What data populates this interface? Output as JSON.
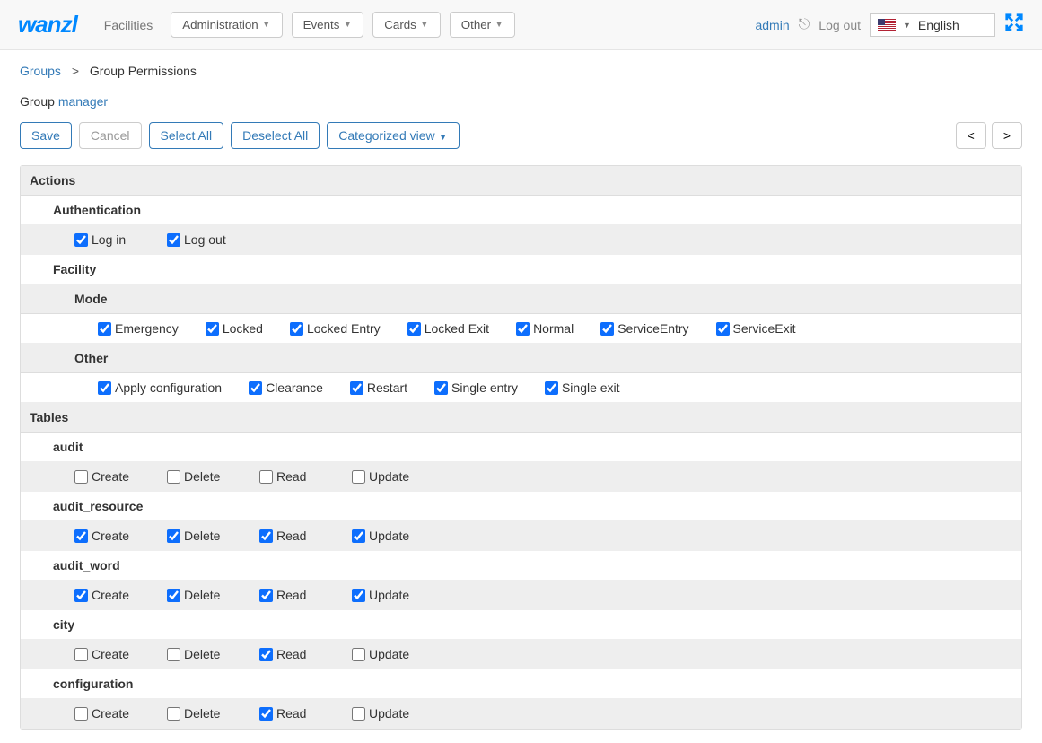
{
  "topbar": {
    "logo": "wanzl",
    "facilities": "Facilities",
    "administration": "Administration",
    "events": "Events",
    "cards": "Cards",
    "other": "Other",
    "admin": "admin",
    "logout": "Log out",
    "language": "English"
  },
  "breadcrumb": {
    "groups": "Groups",
    "sep": ">",
    "current": "Group Permissions"
  },
  "group_line": {
    "label": "Group",
    "name": "manager"
  },
  "buttons": {
    "save": "Save",
    "cancel": "Cancel",
    "select_all": "Select All",
    "deselect_all": "Deselect All",
    "categorized_view": "Categorized view",
    "prev": "<",
    "next": ">"
  },
  "sections": {
    "actions": "Actions",
    "authentication": "Authentication",
    "facility": "Facility",
    "mode": "Mode",
    "other": "Other",
    "tables": "Tables"
  },
  "perms": {
    "auth": {
      "login": {
        "label": "Log in",
        "checked": true
      },
      "logout": {
        "label": "Log out",
        "checked": true
      }
    },
    "mode": {
      "emergency": {
        "label": "Emergency",
        "checked": true
      },
      "locked": {
        "label": "Locked",
        "checked": true
      },
      "locked_entry": {
        "label": "Locked Entry",
        "checked": true
      },
      "locked_exit": {
        "label": "Locked Exit",
        "checked": true
      },
      "normal": {
        "label": "Normal",
        "checked": true
      },
      "service_entry": {
        "label": "ServiceEntry",
        "checked": true
      },
      "service_exit": {
        "label": "ServiceExit",
        "checked": true
      }
    },
    "other": {
      "apply_config": {
        "label": "Apply configuration",
        "checked": true
      },
      "clearance": {
        "label": "Clearance",
        "checked": true
      },
      "restart": {
        "label": "Restart",
        "checked": true
      },
      "single_entry": {
        "label": "Single entry",
        "checked": true
      },
      "single_exit": {
        "label": "Single exit",
        "checked": true
      }
    }
  },
  "tables": {
    "labels": {
      "create": "Create",
      "delete": "Delete",
      "read": "Read",
      "update": "Update"
    },
    "rows": [
      {
        "name": "audit",
        "create": false,
        "delete": false,
        "read": false,
        "update": false
      },
      {
        "name": "audit_resource",
        "create": true,
        "delete": true,
        "read": true,
        "update": true
      },
      {
        "name": "audit_word",
        "create": true,
        "delete": true,
        "read": true,
        "update": true
      },
      {
        "name": "city",
        "create": false,
        "delete": false,
        "read": true,
        "update": false
      },
      {
        "name": "configuration",
        "create": false,
        "delete": false,
        "read": true,
        "update": false
      }
    ]
  }
}
